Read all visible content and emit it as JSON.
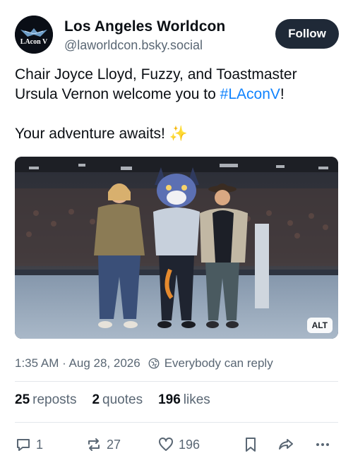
{
  "author": {
    "display_name": "Los Angeles Worldcon",
    "handle": "@laworldcon.bsky.social",
    "avatar_text": "LAcon V"
  },
  "follow_label": "Follow",
  "post": {
    "line1_prefix": "Chair Joyce Lloyd, Fuzzy, and Toastmaster Ursula Vernon welcome you to ",
    "hashtag": "#LAconV",
    "line1_suffix": "!",
    "line2": "Your adventure awaits! ✨"
  },
  "media": {
    "alt_badge": "ALT"
  },
  "meta": {
    "timestamp": "1:35 AM · Aug 28, 2026",
    "reply_setting": "Everybody can reply"
  },
  "counts": {
    "reposts_count": "25",
    "reposts_label": "reposts",
    "quotes_count": "2",
    "quotes_label": "quotes",
    "likes_count": "196",
    "likes_label": "likes"
  },
  "actions": {
    "reply_count": "1",
    "repost_count": "27",
    "like_count": "196"
  },
  "colors": {
    "accent": "#1083fe",
    "follow_bg": "#1f2937",
    "muted": "#5a6774"
  },
  "icons": [
    "reply-icon",
    "repost-icon",
    "heart-icon",
    "bookmark-icon",
    "share-icon",
    "more-icon",
    "globe-icon"
  ]
}
